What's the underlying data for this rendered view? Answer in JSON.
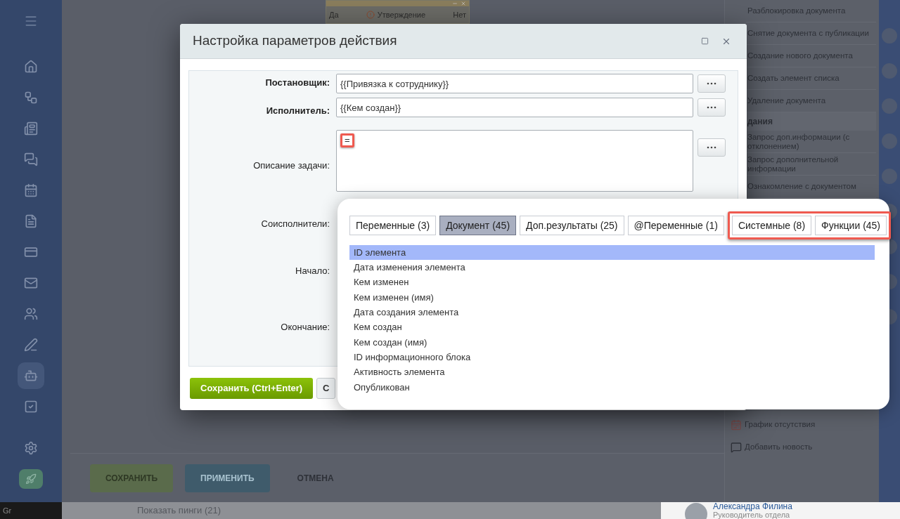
{
  "sidebar": {
    "items": [
      {
        "selected": false
      },
      {
        "selected": false
      },
      {
        "selected": false
      },
      {
        "selected": false
      },
      {
        "selected": false
      },
      {
        "selected": false
      },
      {
        "selected": false
      },
      {
        "selected": false
      },
      {
        "selected": false
      },
      {
        "selected": false
      },
      {
        "selected": true
      },
      {
        "selected": false
      }
    ]
  },
  "background_window": {
    "yes": "Да",
    "title": "Утверждение",
    "no": "Нет"
  },
  "right_panel": {
    "items": [
      {
        "kind": "item",
        "label": "Разблокировка документа"
      },
      {
        "kind": "item",
        "label": "Снятие документа с публикации"
      },
      {
        "kind": "item",
        "label": "Создание нового документа"
      },
      {
        "kind": "item",
        "label": "Создать элемент списка"
      },
      {
        "kind": "item",
        "label": "Удаление документа"
      },
      {
        "kind": "heading",
        "label": "дания"
      },
      {
        "kind": "item",
        "label": "Запрос доп.информации (с отклонением)"
      },
      {
        "kind": "item",
        "label": "Запрос дополнительной информации"
      },
      {
        "kind": "item",
        "label": "Ознакомление с документом"
      }
    ],
    "bottom_items": [
      "График отсутствия",
      "Добавить новость"
    ]
  },
  "bottom_bar": {
    "buttons": [
      "СОХРАНИТЬ",
      "ПРИМЕНИТЬ",
      "ОТМЕНА"
    ]
  },
  "footer": {
    "pings": "Показать пинги (21)",
    "user_name": "Александра Филина",
    "user_role": "Руководитель отдела",
    "corner": "Gr"
  },
  "dialog": {
    "title": "Настройка параметров действия",
    "rows": [
      {
        "label": "Постановщик:",
        "required": true,
        "value": "{{Привязка к сотруднику}}"
      },
      {
        "label": "Исполнитель:",
        "required": true,
        "value": "{{Кем создан}}"
      },
      {
        "label": "Описание задачи:",
        "required": false,
        "value": "=",
        "highlighted": true
      },
      {
        "label": "Соисполнители:",
        "required": false
      },
      {
        "label": "Начало:",
        "required": false
      },
      {
        "label": "Окончание:",
        "required": false
      }
    ],
    "buttons": [
      "Сохранить (Ctrl+Enter)",
      "С"
    ]
  },
  "popup": {
    "tabs": [
      {
        "label": "Переменные (3)",
        "selected": false,
        "highlighted": false
      },
      {
        "label": "Документ (45)",
        "selected": true,
        "highlighted": false
      },
      {
        "label": "Доп.результаты (25)",
        "selected": false,
        "highlighted": false
      },
      {
        "label": "@Переменные (1)",
        "selected": false,
        "highlighted": false
      },
      {
        "label": "Системные (8)",
        "selected": false,
        "highlighted": true
      },
      {
        "label": "Функции (45)",
        "selected": false,
        "highlighted": true
      }
    ],
    "items": [
      {
        "label": "ID элемента",
        "selected": true
      },
      {
        "label": "Дата изменения элемента",
        "selected": false
      },
      {
        "label": "Кем изменен",
        "selected": false
      },
      {
        "label": "Кем изменен (имя)",
        "selected": false
      },
      {
        "label": "Дата создания элемента",
        "selected": false
      },
      {
        "label": "Кем создан",
        "selected": false
      },
      {
        "label": "Кем создан (имя)",
        "selected": false
      },
      {
        "label": "ID информационного блока",
        "selected": false
      },
      {
        "label": "Активность элемента",
        "selected": false
      },
      {
        "label": "Опубликован",
        "selected": false
      }
    ]
  }
}
